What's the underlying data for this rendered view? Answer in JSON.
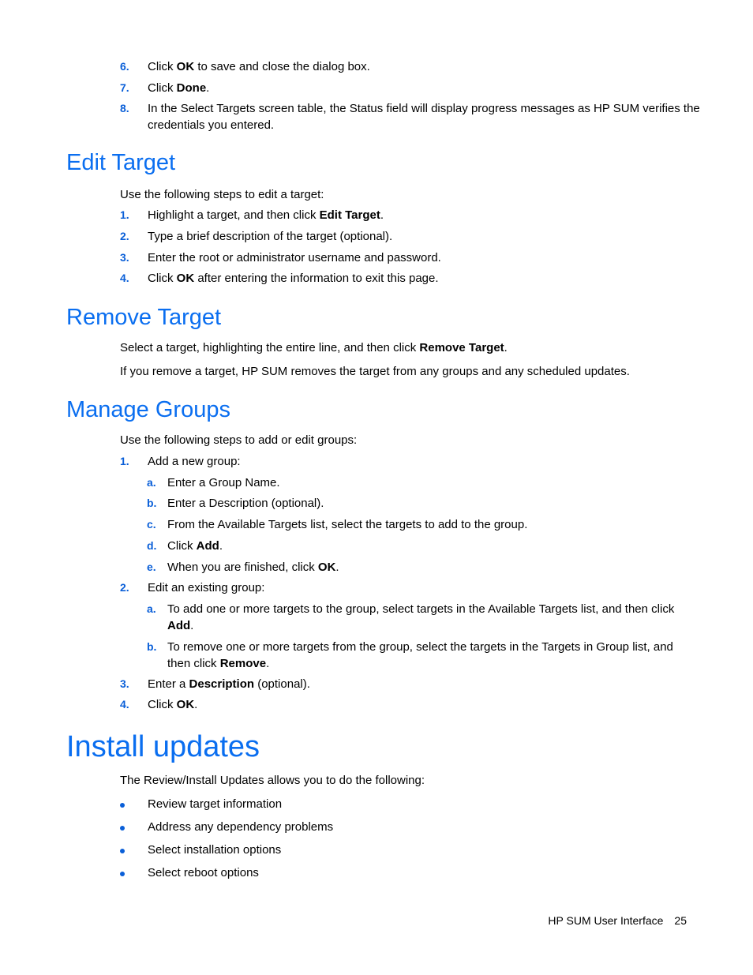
{
  "top_steps": [
    {
      "num": "6.",
      "pre": "Click ",
      "bold": "OK",
      "post": " to save and close the dialog box."
    },
    {
      "num": "7.",
      "pre": "Click ",
      "bold": "Done",
      "post": "."
    },
    {
      "num": "8.",
      "line1": "In the Select Targets screen table, the Status field will display progress messages as HP SUM verifies the",
      "line2": "credentials you entered."
    }
  ],
  "edit_target": {
    "heading": "Edit Target",
    "intro": "Use the following steps to edit a target:",
    "steps": [
      {
        "num": "1.",
        "pre": "Highlight a target, and then click ",
        "bold": "Edit Target",
        "post": "."
      },
      {
        "num": "2.",
        "text": "Type a brief description of the target (optional)."
      },
      {
        "num": "3.",
        "text": "Enter the root or administrator username and password."
      },
      {
        "num": "4.",
        "pre": "Click ",
        "bold": "OK",
        "post": " after entering the information to exit this page."
      }
    ]
  },
  "remove_target": {
    "heading": "Remove Target",
    "p1_pre": "Select a target, highlighting the entire line, and then click ",
    "p1_bold": "Remove Target",
    "p1_post": ".",
    "p2": "If you remove a target, HP SUM removes the target from any groups and any scheduled updates."
  },
  "manage_groups": {
    "heading": "Manage Groups",
    "intro": "Use the following steps to add or edit groups:",
    "step1": {
      "num": "1.",
      "text": "Add a new group:",
      "subs": [
        {
          "letter": "a.",
          "text": "Enter a Group Name."
        },
        {
          "letter": "b.",
          "text": "Enter a Description (optional)."
        },
        {
          "letter": "c.",
          "text": "From the Available Targets list, select the targets to add to the group."
        },
        {
          "letter": "d.",
          "pre": "Click ",
          "bold": "Add",
          "post": "."
        },
        {
          "letter": "e.",
          "pre": "When you are finished, click ",
          "bold": "OK",
          "post": "."
        }
      ]
    },
    "step2": {
      "num": "2.",
      "text": "Edit an existing group:",
      "subs": [
        {
          "letter": "a.",
          "line1": "To add one or more targets to the group, select targets in the Available Targets list, and then click",
          "bold": "Add",
          "post": "."
        },
        {
          "letter": "b.",
          "line1": "To remove one or more targets from the group, select the targets in the Targets in Group list, and",
          "pre": "then click ",
          "bold": "Remove",
          "post": "."
        }
      ]
    },
    "step3": {
      "num": "3.",
      "pre": "Enter a ",
      "bold": "Description",
      "post": " (optional)."
    },
    "step4": {
      "num": "4.",
      "pre": "Click ",
      "bold": "OK",
      "post": "."
    }
  },
  "install_updates": {
    "heading": "Install updates",
    "intro": "The Review/Install Updates allows you to do the following:",
    "bullets": [
      "Review target information",
      "Address any dependency problems",
      "Select installation options",
      "Select reboot options"
    ]
  },
  "footer": {
    "section": "HP SUM User Interface",
    "page": "25"
  }
}
